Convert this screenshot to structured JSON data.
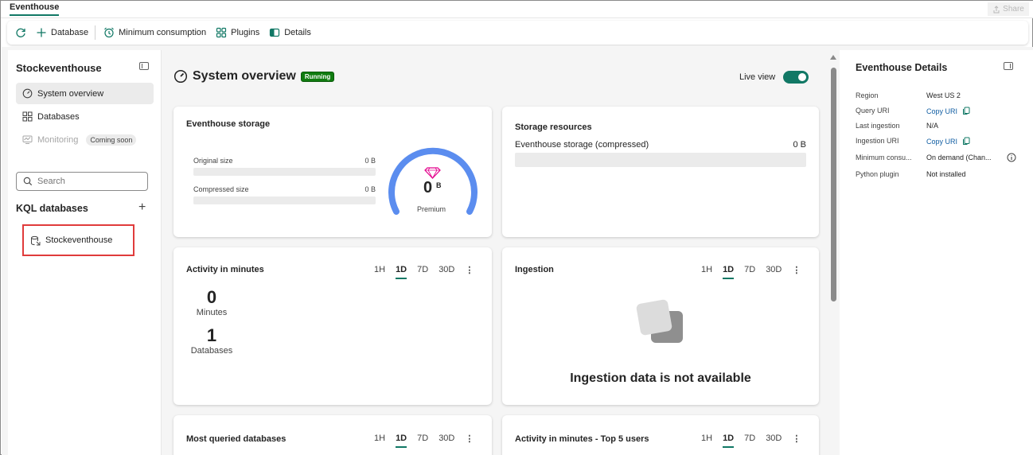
{
  "app": {
    "tab": "Eventhouse",
    "share_label": "Share"
  },
  "toolbar": {
    "database_label": "Database",
    "min_consumption_label": "Minimum consumption",
    "plugins_label": "Plugins",
    "details_label": "Details"
  },
  "left": {
    "title": "Stockeventhouse",
    "nav": {
      "system_overview": "System overview",
      "databases": "Databases",
      "monitoring": "Monitoring",
      "coming_soon": "Coming soon"
    },
    "search_placeholder": "Search",
    "kql_title": "KQL databases",
    "db_item": "Stockeventhouse"
  },
  "overview": {
    "title": "System overview",
    "status": "Running",
    "live_view": "Live view",
    "live_view_on": true
  },
  "storage_card": {
    "title": "Eventhouse storage",
    "original_label": "Original size",
    "original_value": "0 B",
    "compressed_label": "Compressed size",
    "compressed_value": "0 B",
    "gauge_value": "0",
    "gauge_unit": "B",
    "gauge_tier": "Premium"
  },
  "resources_card": {
    "title": "Storage resources",
    "row_label": "Eventhouse storage (compressed)",
    "row_value": "0 B"
  },
  "ranges": [
    "1H",
    "1D",
    "7D",
    "30D"
  ],
  "activity_card": {
    "title": "Activity in minutes",
    "minutes_value": "0",
    "minutes_label": "Minutes",
    "databases_value": "1",
    "databases_label": "Databases"
  },
  "ingestion_card": {
    "title": "Ingestion",
    "empty_text": "Ingestion data is not available"
  },
  "most_queried_card": {
    "title": "Most queried databases"
  },
  "top_users_card": {
    "title": "Activity in minutes - Top 5 users"
  },
  "details": {
    "title": "Eventhouse Details",
    "rows": [
      {
        "label": "Region",
        "value": "West US 2"
      },
      {
        "label": "Query URI",
        "value": "Copy URI"
      },
      {
        "label": "Last ingestion",
        "value": "N/A"
      },
      {
        "label": "Ingestion URI",
        "value": "Copy URI"
      },
      {
        "label": "Minimum consu...",
        "value": "On demand (Chan..."
      },
      {
        "label": "Python plugin",
        "value": "Not installed"
      }
    ]
  },
  "colors": {
    "accent": "#117865",
    "running": "#107c10",
    "link": "#115ea3",
    "highlight_border": "#e03b3b",
    "gauge": "#5b8def"
  }
}
